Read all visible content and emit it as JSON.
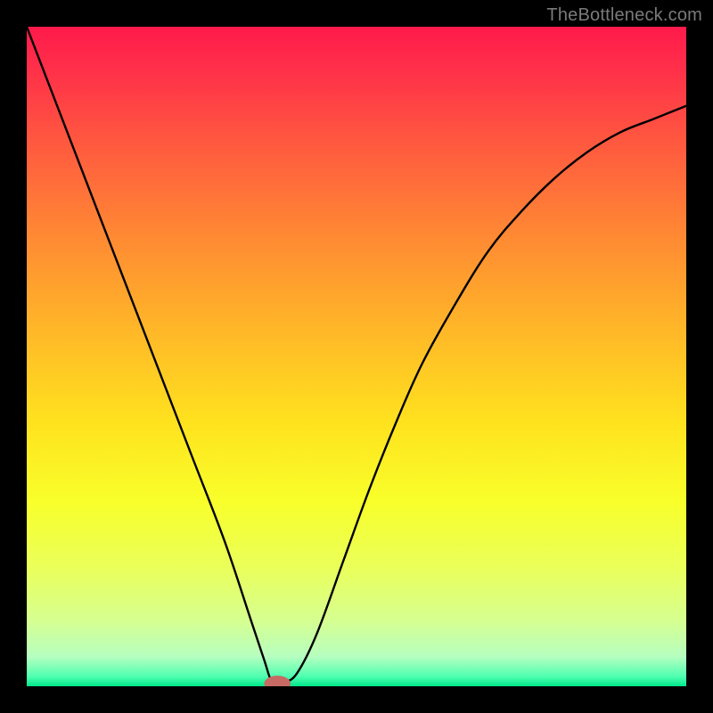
{
  "watermark": "TheBottleneck.com",
  "chart_data": {
    "type": "line",
    "title": "",
    "xlabel": "",
    "ylabel": "",
    "xlim": [
      0,
      100
    ],
    "ylim": [
      0,
      100
    ],
    "minimum_x": 38,
    "minimum_y": 0,
    "curve_points": [
      {
        "x": 0,
        "y": 100
      },
      {
        "x": 5,
        "y": 87
      },
      {
        "x": 10,
        "y": 74
      },
      {
        "x": 15,
        "y": 61
      },
      {
        "x": 20,
        "y": 48
      },
      {
        "x": 25,
        "y": 35
      },
      {
        "x": 30,
        "y": 22
      },
      {
        "x": 34,
        "y": 10
      },
      {
        "x": 36,
        "y": 4
      },
      {
        "x": 37,
        "y": 1
      },
      {
        "x": 38,
        "y": 0
      },
      {
        "x": 39,
        "y": 0.5
      },
      {
        "x": 41,
        "y": 2
      },
      {
        "x": 44,
        "y": 8
      },
      {
        "x": 48,
        "y": 19
      },
      {
        "x": 52,
        "y": 30
      },
      {
        "x": 56,
        "y": 40
      },
      {
        "x": 60,
        "y": 49
      },
      {
        "x": 65,
        "y": 58
      },
      {
        "x": 70,
        "y": 66
      },
      {
        "x": 75,
        "y": 72
      },
      {
        "x": 80,
        "y": 77
      },
      {
        "x": 85,
        "y": 81
      },
      {
        "x": 90,
        "y": 84
      },
      {
        "x": 95,
        "y": 86
      },
      {
        "x": 100,
        "y": 88
      }
    ],
    "marker": {
      "x": 38,
      "y": 0,
      "rx": 2.0,
      "ry": 1.2,
      "color": "#c76a63"
    },
    "gradient_stops": [
      {
        "offset": 0,
        "color": "#ff1a4a"
      },
      {
        "offset": 0.06,
        "color": "#ff2e4a"
      },
      {
        "offset": 0.18,
        "color": "#ff5a3f"
      },
      {
        "offset": 0.32,
        "color": "#ff8a33"
      },
      {
        "offset": 0.46,
        "color": "#ffb728"
      },
      {
        "offset": 0.6,
        "color": "#ffe21e"
      },
      {
        "offset": 0.72,
        "color": "#f8ff2a"
      },
      {
        "offset": 0.82,
        "color": "#eaff5a"
      },
      {
        "offset": 0.9,
        "color": "#d6ff90"
      },
      {
        "offset": 0.955,
        "color": "#b6ffc0"
      },
      {
        "offset": 0.985,
        "color": "#50ffb0"
      },
      {
        "offset": 1.0,
        "color": "#00e88a"
      }
    ]
  }
}
